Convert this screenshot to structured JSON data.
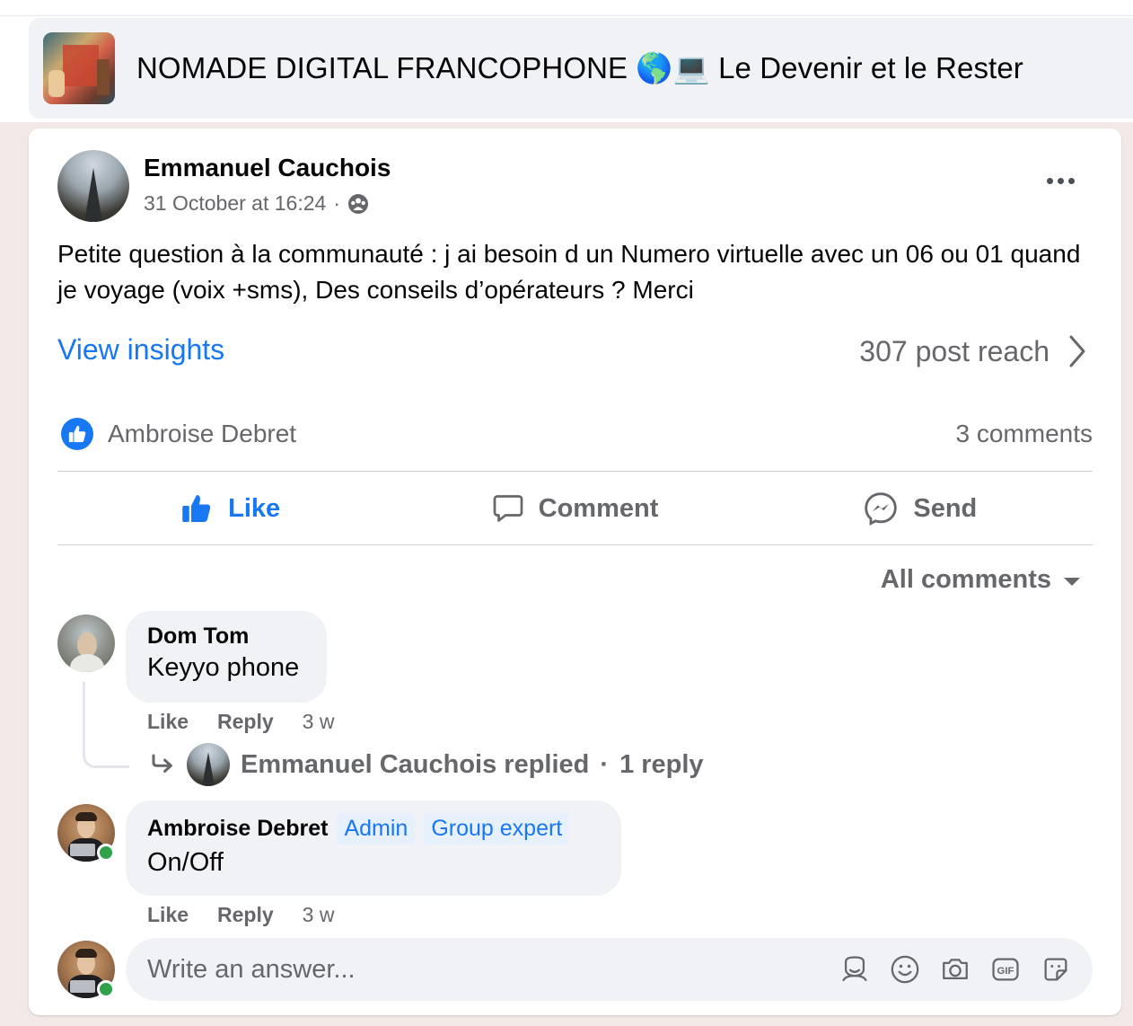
{
  "group": {
    "title": "NOMADE DIGITAL FRANCOPHONE 🌎💻 Le Devenir et le Rester",
    "thumbnail_icon": "group-cover-image"
  },
  "post": {
    "author": "Emmanuel Cauchois",
    "timestamp": "31 October at 16:24",
    "separator": "·",
    "audience_icon": "group-members-icon",
    "text": "Petite question à la communauté : j ai besoin d un Numero virtuelle avec un 06 ou 01 quand je voyage (voix +sms), Des conseils d’opérateurs ? Merci",
    "view_insights": "View insights",
    "reach": "307 post reach",
    "reactor": "Ambroise Debret",
    "comments_count": "3 comments"
  },
  "actions": {
    "like": "Like",
    "comment": "Comment",
    "send": "Send"
  },
  "comments_filter": "All comments",
  "comments": [
    {
      "author": "Dom Tom",
      "text": "Keyyo phone",
      "like": "Like",
      "reply": "Reply",
      "time": "3 w",
      "replies_summary": {
        "text": "Emmanuel Cauchois replied",
        "separator": "·",
        "count": "1 reply"
      }
    },
    {
      "author": "Ambroise Debret",
      "badges": [
        "Admin",
        "Group expert"
      ],
      "text": "On/Off",
      "like": "Like",
      "reply": "Reply",
      "time": "3 w"
    }
  ],
  "composer": {
    "placeholder": "Write an answer...",
    "icons": [
      "avatar-sticker-icon",
      "emoji-icon",
      "camera-icon",
      "gif-icon",
      "sticker-icon"
    ]
  },
  "colors": {
    "accent": "#1877f2",
    "secondary_text": "#65676b",
    "online": "#31a24c",
    "bubble": "#f0f2f5",
    "page_background": "#f2e8e6"
  }
}
